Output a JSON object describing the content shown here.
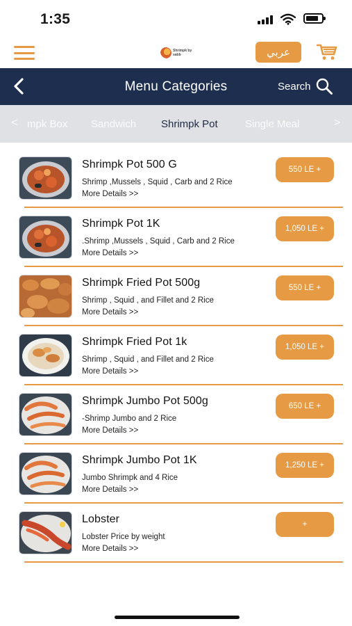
{
  "status": {
    "time": "1:35"
  },
  "topbar": {
    "language_label": "عربي",
    "logo_text": "Shrimpk by sabb"
  },
  "header": {
    "title": "Menu Categories",
    "search_label": "Search"
  },
  "tabs": {
    "items": [
      {
        "label": "mpk Box",
        "active": false
      },
      {
        "label": "Sandwich",
        "active": false
      },
      {
        "label": "Shrimpk Pot",
        "active": true
      },
      {
        "label": "Single Meal",
        "active": false
      }
    ],
    "prev_arrow": "<",
    "next_arrow": ">"
  },
  "items": [
    {
      "name": "Shrimpk Pot 500 G",
      "desc": "Shrimp ,Mussels , Squid , Carb and 2 Rice",
      "more": "More Details >>",
      "price": "550 LE +",
      "thumb": "seafood-pot"
    },
    {
      "name": "Shrimpk Pot 1K",
      "desc": ".Shrimp ,Mussels , Squid , Carb and 2 Rice",
      "more": "More Details >>",
      "price": "1,050 LE +",
      "thumb": "seafood-pot"
    },
    {
      "name": "Shrimpk Fried Pot 500g",
      "desc": "Shrimp  , Squid , and Fillet  and 2 Rice",
      "more": "More Details >>",
      "price": "550 LE +",
      "thumb": "fried-shrimp"
    },
    {
      "name": "Shrimpk Fried Pot 1k",
      "desc": "Shrimp  , Squid , and Fillet  and 2 Rice",
      "more": "More Details >>",
      "price": "1,050 LE +",
      "thumb": "fried-plate"
    },
    {
      "name": "Shrimpk Jumbo Pot 500g",
      "desc": "-Shrimp Jumbo and 2 Rice",
      "more": "More Details >>",
      "price": "650 LE +",
      "thumb": "jumbo-shrimp"
    },
    {
      "name": "Shrimpk Jumbo Pot 1K",
      "desc": "Jumbo Shrimpk and 4 Rice",
      "more": "More Details >>",
      "price": "1,250 LE +",
      "thumb": "jumbo-shrimp"
    },
    {
      "name": "Lobster",
      "desc": "Lobster Price by weight",
      "more": "More Details >>",
      "price": "+",
      "thumb": "lobster"
    }
  ],
  "colors": {
    "accent": "#e59a43",
    "header_bg": "#1d2e4e",
    "tabs_bg": "#dfe1e4"
  }
}
